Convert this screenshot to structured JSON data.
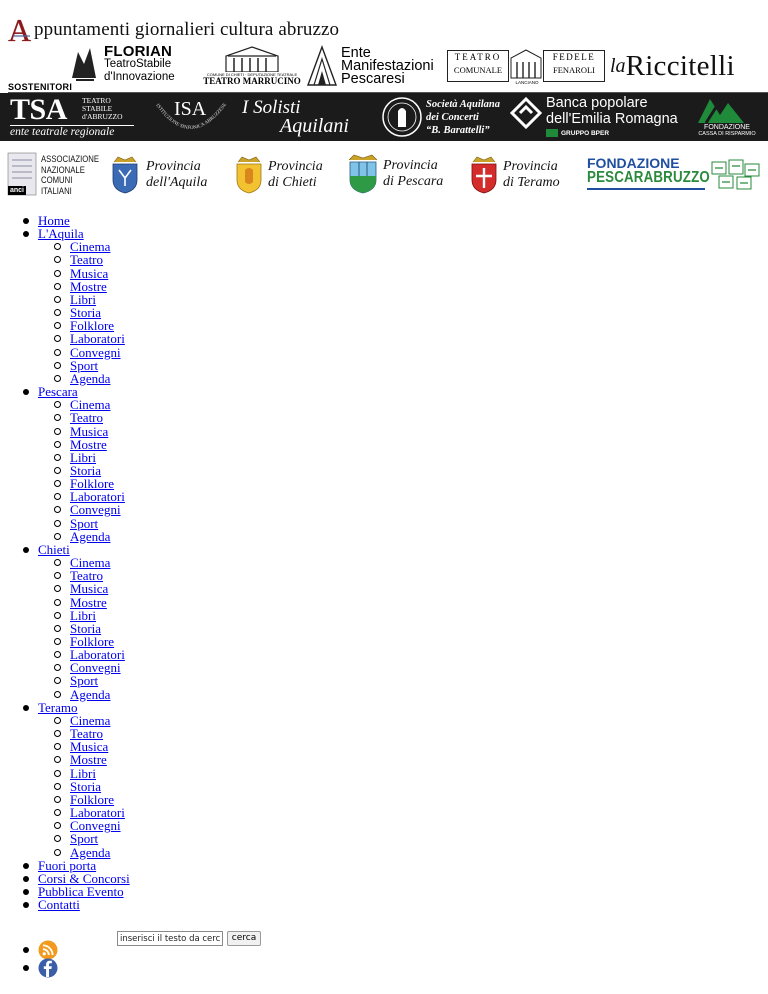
{
  "header": {
    "title_initial": "A",
    "title_rest": "ppuntamenti giornalieri cultura abruzzo"
  },
  "sponsors": {
    "sostenitori_label": "SOSTENITORI",
    "florian": {
      "name": "FLORIAN",
      "line2": "TeatroStabile",
      "line3": "d'Innovazione"
    },
    "marrucino": {
      "top": "COMUNE DI CHIETI · DEPUTAZIONE TEATRALE",
      "name": "TEATRO MARRUCINO"
    },
    "ente": {
      "l1": "Ente",
      "l2": "Manifestazioni",
      "l3": "Pescaresi"
    },
    "fenaroli": {
      "t1": "TEATRO",
      "t2": "COMUNALE",
      "f1": "FEDELE",
      "f2": "FENAROLI",
      "city": "LANCIANO"
    },
    "riccitelli": {
      "la": "la",
      "name": "Riccitelli"
    },
    "tsa": {
      "name": "TSA",
      "s1": "TEATRO",
      "s2": "STABILE",
      "s3": "d'ABRUZZO",
      "tag": "ente teatrale regionale"
    },
    "isa": {
      "name": "ISA",
      "arc": "ISTITUZIONE SINFONICA ABRUZZESE"
    },
    "solisti": {
      "l1": "I Solisti",
      "l2": "Aquilani"
    },
    "barattelli": {
      "l1": "Società Aquilana",
      "l2": "dei Concerti",
      "l3": "“B. Barattelli”"
    },
    "bper": {
      "l1": "Banca popolare",
      "l2": "dell'Emilia Romagna",
      "group": "GRUPPO BPER"
    },
    "fondazione_carisp": {
      "l1": "FONDAZIONE",
      "l2": "CASSA DI RISPARMIO"
    },
    "anci": {
      "l1": "ASSOCIAZIONE",
      "l2": "NAZIONALE",
      "l3": "COMUNI",
      "l4": "ITALIANI",
      "abbr": "anci"
    },
    "provinces": [
      {
        "l1": "Provincia",
        "l2": "dell'Aquila"
      },
      {
        "l1": "Provincia",
        "l2": "di Chieti"
      },
      {
        "l1": "Provincia",
        "l2": "di Pescara"
      },
      {
        "l1": "Provincia",
        "l2": "di Teramo"
      }
    ],
    "pescarabruzzo": {
      "l1": "FONDAZIONE",
      "l2": "PESCARABRUZZO"
    }
  },
  "nav": {
    "home": "Home",
    "laquila": "L'Aquila",
    "pescara": "Pescara",
    "chieti": "Chieti",
    "teramo": "Teramo",
    "sub": [
      "Cinema",
      "Teatro",
      "Musica",
      "Mostre",
      "Libri",
      "Storia",
      "Folklore",
      "Laboratori",
      "Convegni",
      "Sport",
      "Agenda"
    ],
    "fuori_porta": "Fuori porta",
    "corsi": "Corsi & Concorsi",
    "pubblica": "Pubblica Evento",
    "contatti": "Contatti"
  },
  "search": {
    "value": "inserisci il testo da cercare",
    "button": "cerca"
  },
  "colors": {
    "link": "#0000ee",
    "band": "#1b1b1b",
    "bper_green": "#1e8a3a",
    "title_a": "#8b1a1a"
  }
}
